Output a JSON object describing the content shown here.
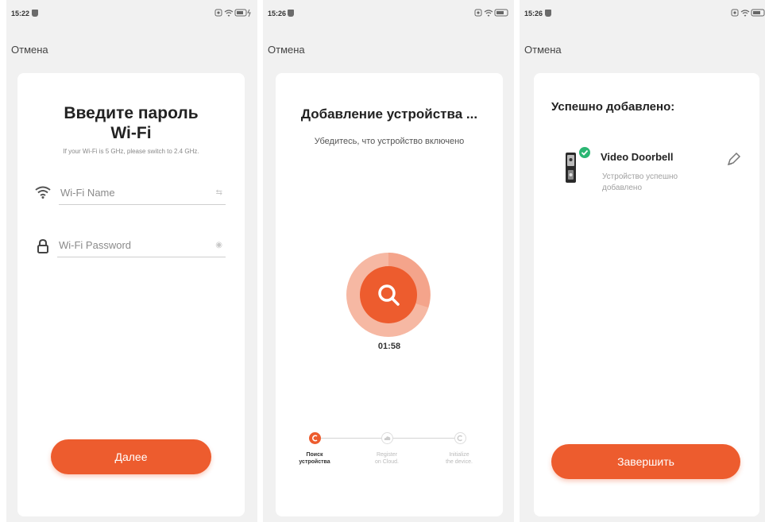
{
  "screens": [
    {
      "status_time": "15:22",
      "cancel": "Отмена",
      "title_line1": "Введите пароль",
      "title_line2": "Wi-Fi",
      "hint": "If your Wi-Fi is 5 GHz, please switch to 2.4 GHz.",
      "wifi_name_placeholder": "Wi-Fi Name",
      "wifi_password_placeholder": "Wi-Fi Password",
      "next_button": "Далее"
    },
    {
      "status_time": "15:26",
      "cancel": "Отмена",
      "title": "Добавление устройства ...",
      "subtitle": "Убедитесь, что устройство включено",
      "timer": "01:58",
      "steps": [
        {
          "label_line1": "Поиск",
          "label_line2": "устройства",
          "active": true
        },
        {
          "label_line1": "Register",
          "label_line2": "on Cloud.",
          "active": false
        },
        {
          "label_line1": "Initialize",
          "label_line2": "the device.",
          "active": false
        }
      ]
    },
    {
      "status_time": "15:26",
      "cancel": "Отмена",
      "title": "Успешно добавлено:",
      "device_name": "Video Doorbell",
      "device_status": "Устройство успешно добавлено",
      "finish_button": "Завершить"
    }
  ],
  "colors": {
    "accent": "#ed5c2e",
    "accent_light": "#f4a48b",
    "success": "#2bb673",
    "card": "#ffffff",
    "background": "#f1f1f1"
  },
  "icons": [
    "wifi-icon",
    "lock-icon",
    "wifi-list-icon",
    "eye-icon",
    "search-icon",
    "check-icon",
    "pencil-icon",
    "camera-status-icon",
    "battery-icon"
  ]
}
